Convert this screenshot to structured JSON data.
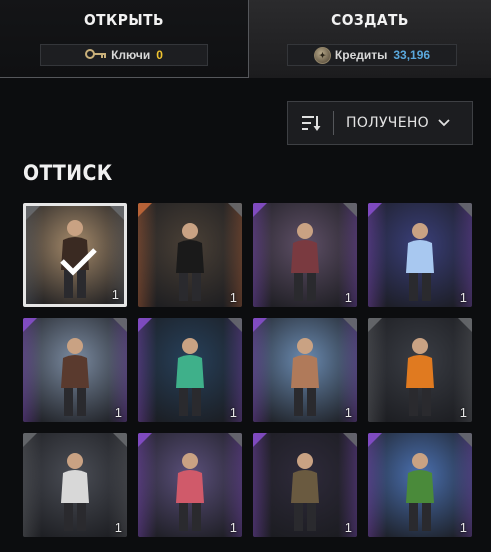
{
  "tabs": {
    "open": {
      "title": "ОТКРЫТЬ",
      "pill_label": "Ключи",
      "pill_value": "0",
      "icon": "key-icon"
    },
    "create": {
      "title": "СОЗДАТЬ",
      "pill_label": "Кредиты",
      "pill_value": "33,196",
      "icon": "credits-coin-icon"
    }
  },
  "sort": {
    "label": "ПОЛУЧЕНО",
    "icon": "sort-icon",
    "dropdown_icon": "chevron-down-icon"
  },
  "section": {
    "title": "ОТТИСК"
  },
  "colors": {
    "keys_value": "#f0c430",
    "credits_value": "#5aa8dc",
    "rarity_orange": "#c86a3a",
    "rarity_purple": "#8a4fd0",
    "rarity_gray": "#6a6c70"
  },
  "items": [
    {
      "qty": "1",
      "selected": true,
      "rarity": "gray",
      "bg": "#a58a6a",
      "fig": "#3a2a22"
    },
    {
      "qty": "1",
      "selected": false,
      "rarity": "orange",
      "bg": "#4a4036",
      "fig": "#1a1a1a"
    },
    {
      "qty": "1",
      "selected": false,
      "rarity": "purple",
      "bg": "#5e4f66",
      "fig": "#7a3a40"
    },
    {
      "qty": "1",
      "selected": false,
      "rarity": "purple",
      "bg": "#3a3f7a",
      "fig": "#a8c8f0"
    },
    {
      "qty": "1",
      "selected": false,
      "rarity": "purple",
      "bg": "#7a8aa0",
      "fig": "#5a3a2e"
    },
    {
      "qty": "1",
      "selected": false,
      "rarity": "purple",
      "bg": "#27405a",
      "fig": "#3fb08a"
    },
    {
      "qty": "1",
      "selected": false,
      "rarity": "purple",
      "bg": "#6a8ab0",
      "fig": "#b07a5a"
    },
    {
      "qty": "1",
      "selected": false,
      "rarity": "gray",
      "bg": "#3a3d44",
      "fig": "#e07a20"
    },
    {
      "qty": "1",
      "selected": false,
      "rarity": "gray",
      "bg": "#4a4d55",
      "fig": "#d8d8d8"
    },
    {
      "qty": "1",
      "selected": false,
      "rarity": "purple",
      "bg": "#5a4f7a",
      "fig": "#d05a6a"
    },
    {
      "qty": "1",
      "selected": false,
      "rarity": "purple",
      "bg": "#2e2a3a",
      "fig": "#6a5a40"
    },
    {
      "qty": "1",
      "selected": false,
      "rarity": "purple",
      "bg": "#4a70b0",
      "fig": "#4a8a3a"
    }
  ]
}
